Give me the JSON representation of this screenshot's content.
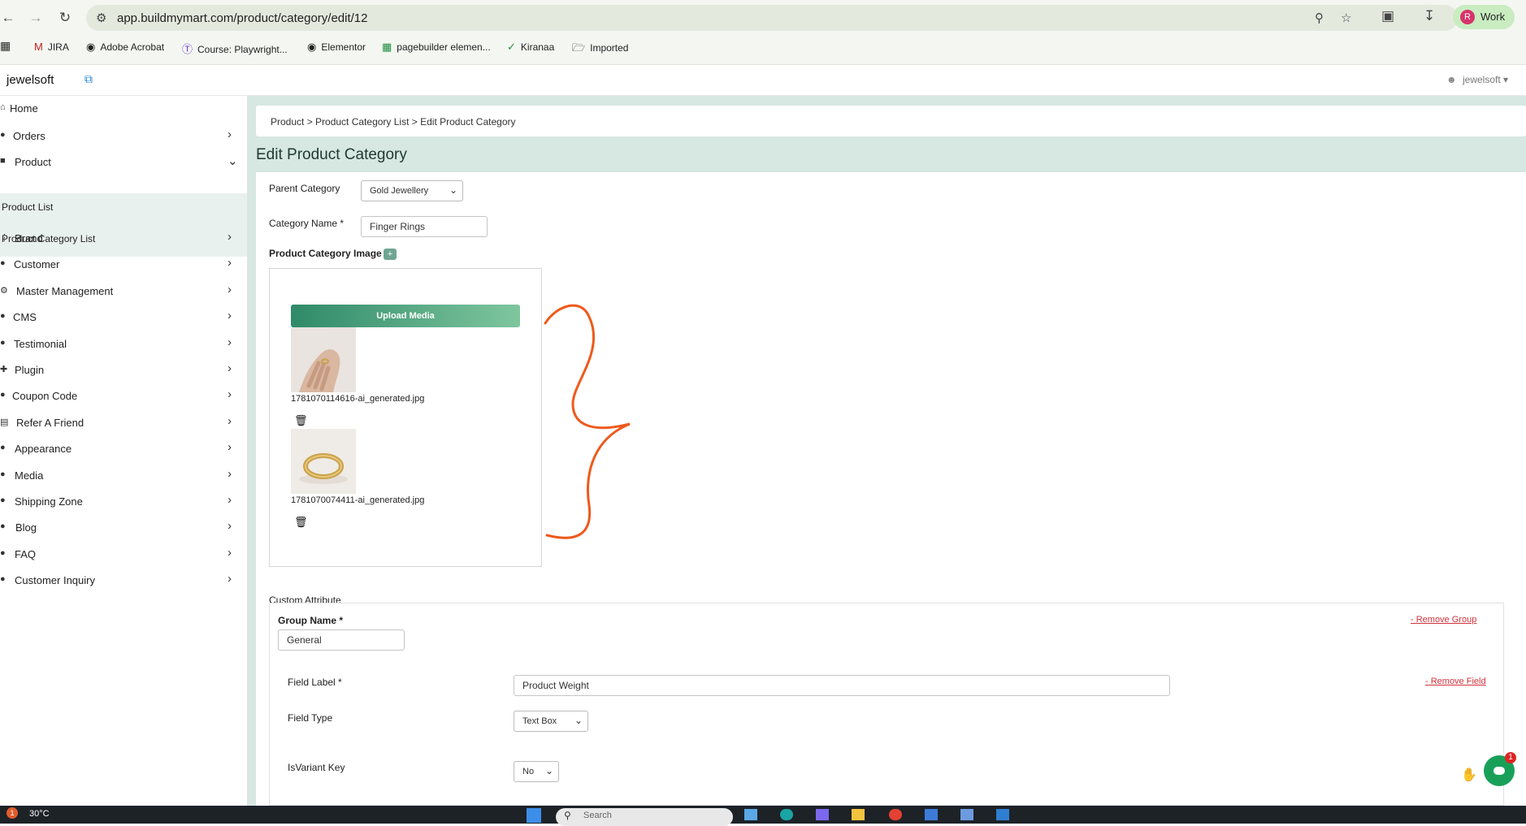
{
  "browser": {
    "url": "app.buildmymart.com/product/category/edit/12",
    "profile_initial": "R",
    "profile_label": "Work",
    "bookmarks": [
      {
        "label": "JIRA",
        "icon": "gmail-icon"
      },
      {
        "label": "Adobe Acrobat",
        "icon": "acrobat-icon"
      },
      {
        "label": "Course: Playwright...",
        "icon": "course-icon"
      },
      {
        "label": "Elementor",
        "icon": "elementor-icon"
      },
      {
        "label": "pagebuilder elemen...",
        "icon": "sheets-icon"
      },
      {
        "label": "Kiranaa",
        "icon": "check-circle-icon"
      },
      {
        "label": "Imported",
        "icon": "folder-icon"
      }
    ]
  },
  "app": {
    "brand": "jewelsoft",
    "user": "jewelsoft"
  },
  "sidebar": {
    "items": [
      {
        "label": "Home",
        "chevron": false
      },
      {
        "label": "Orders",
        "chevron": true
      },
      {
        "label": "Product",
        "chevron": true,
        "expanded": true
      },
      {
        "label": "Brand",
        "chevron": true
      },
      {
        "label": "Customer",
        "chevron": true
      },
      {
        "label": "Master Management",
        "chevron": true
      },
      {
        "label": "CMS",
        "chevron": true
      },
      {
        "label": "Testimonial",
        "chevron": true
      },
      {
        "label": "Plugin",
        "chevron": true
      },
      {
        "label": "Coupon Code",
        "chevron": true
      },
      {
        "label": "Refer A Friend",
        "chevron": true
      },
      {
        "label": "Appearance",
        "chevron": true
      },
      {
        "label": "Media",
        "chevron": true
      },
      {
        "label": "Shipping Zone",
        "chevron": true
      },
      {
        "label": "Blog",
        "chevron": true
      },
      {
        "label": "FAQ",
        "chevron": true
      },
      {
        "label": "Customer Inquiry",
        "chevron": true
      }
    ],
    "sub_items": [
      "Product List",
      "Product Category List"
    ]
  },
  "breadcrumb": "Product > Product Category List > Edit Product Category",
  "page_title": "Edit Product Category",
  "form": {
    "parent_category_label": "Parent Category",
    "parent_category_value": "Gold Jewellery",
    "category_name_label": "Category Name *",
    "category_name_value": "Finger Rings",
    "image_label": "Product Category Image",
    "upload_button": "Upload Media",
    "images": [
      {
        "filename": "1781070114616-ai_generated.jpg"
      },
      {
        "filename": "1781070074411-ai_generated.jpg"
      }
    ],
    "custom_attribute_label": "Custom Attribute",
    "group_name_label": "Group Name *",
    "group_name_value": "General",
    "remove_group": "- Remove Group",
    "field_label_label": "Field Label *",
    "field_label_value": "Product Weight",
    "remove_field": "- Remove Field",
    "field_type_label": "Field Type",
    "field_type_value": "Text Box",
    "isvariant_label": "IsVariant Key",
    "isvariant_value": "No"
  },
  "taskbar": {
    "weather": "30°C",
    "weather_badge": "1",
    "search_placeholder": "Search"
  },
  "chat_badge": "1",
  "accent_colors": {
    "primary": "#2f8a69",
    "danger": "#d3323c",
    "annotation": "#ee5a1c"
  }
}
